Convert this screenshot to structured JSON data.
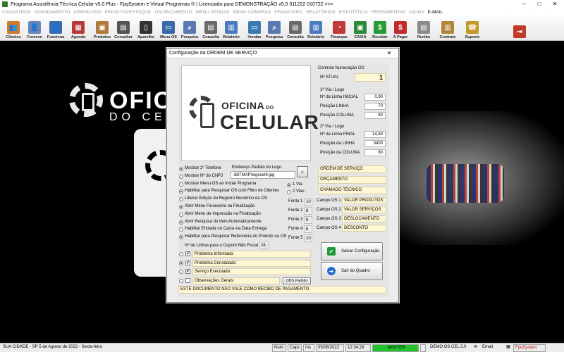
{
  "window": {
    "title": "Programa Assistência Técnica Celular v5.0 Plus - FpqSystem e Virtual Programas ® | Licenciado para  DEMONSTRAÇÃO v5.0 311222 010722 >>>",
    "min_glyph": "–",
    "max_glyph": "□",
    "close_glyph": "✕"
  },
  "menu": [
    "CADASTROS",
    "AGENDAMENTO",
    "APARELHOS",
    "PRODUTO/ESTOQUE",
    "OS/ORÇAMENTO",
    "MENU VENDAS",
    "MENU COMPRAS",
    "FINANCEIRO",
    "RELATÓRIOS",
    "ESTATÍSTICA",
    "FERRAMENTAS",
    "AJUDA",
    "E-MAIL"
  ],
  "toolbar": {
    "buttons": [
      {
        "label": "Clientes",
        "icon": "users-icon",
        "color": "#d07a2a"
      },
      {
        "label": "Fornece",
        "icon": "supplier-icon",
        "color": "#6a86b8"
      },
      {
        "label": "Funciona",
        "icon": "employee-icon",
        "color": "#3a6ab0"
      },
      {
        "label": "Agenda",
        "icon": "calendar-icon",
        "color": "#b73a3a"
      },
      {
        "label": "Produtos",
        "icon": "box-icon",
        "color": "#b07a3a"
      },
      {
        "label": "Consultar",
        "icon": "register-icon",
        "color": "#555555"
      },
      {
        "label": "Aparelho",
        "icon": "phone-icon",
        "color": "#333333"
      },
      {
        "label": "Menu OS",
        "icon": "computer-icon",
        "color": "#3a6aa8"
      },
      {
        "label": "Pesquisa",
        "icon": "search-icon",
        "color": "#5a7ab0"
      },
      {
        "label": "Consulta",
        "icon": "document-icon",
        "color": "#6a6a6a"
      },
      {
        "label": "Relatório",
        "icon": "report-icon",
        "color": "#4a7ac0"
      },
      {
        "label": "Vendas",
        "icon": "sales-icon",
        "color": "#3a7ab0"
      },
      {
        "label": "Pesquisa",
        "icon": "search-icon",
        "color": "#5a7ab0"
      },
      {
        "label": "Consulta",
        "icon": "document-icon",
        "color": "#6a6a6a"
      },
      {
        "label": "Relatório",
        "icon": "report-icon",
        "color": "#4a7ac0"
      },
      {
        "label": "Finanças",
        "icon": "chart-icon",
        "color": "#c03a3a"
      },
      {
        "label": "CAIXA",
        "icon": "cash-icon",
        "color": "#2a8a3a"
      },
      {
        "label": "Receber",
        "icon": "money-in-icon",
        "color": "#2a9a3a"
      },
      {
        "label": "A Pagar",
        "icon": "money-out-icon",
        "color": "#c02a2a"
      },
      {
        "label": "Recibo",
        "icon": "receipt-icon",
        "color": "#8a8a8a"
      },
      {
        "label": "Contrato",
        "icon": "contract-icon",
        "color": "#b0863a"
      },
      {
        "label": "Suporte",
        "icon": "support-icon",
        "color": "#c09a2a"
      },
      {
        "label": "",
        "icon": "exit-icon",
        "color": "#c03a2a"
      }
    ]
  },
  "background": {
    "brand_line1": "OFICINA",
    "brand_line2": "DO CELULAR"
  },
  "dialog": {
    "title": "Configuração da ORDEM DE SERVIÇO",
    "logo": {
      "line1": "OFICINA",
      "line1_small": "DO",
      "line2": "CELULAR"
    },
    "numbering": {
      "group_label": "Controle Numeração OS",
      "n_atual_label": "Nº ATUAL",
      "n_atual_value": "1"
    },
    "via1": {
      "group_label": "1ª Via / Logo",
      "rows": [
        {
          "label": "Nº da Linha INICIAL",
          "value": "0,90"
        },
        {
          "label": "Posição LINHA",
          "value": "70"
        },
        {
          "label": "Posição COLUNA",
          "value": "80"
        }
      ]
    },
    "via2": {
      "group_label": "2ª Via / Logo",
      "rows": [
        {
          "label": "Nº da Linha FINAL",
          "value": "14,50"
        },
        {
          "label": "Posição da LINHA",
          "value": "3400"
        },
        {
          "label": "Posição da COLUNA",
          "value": "80"
        }
      ]
    },
    "logo_path": {
      "label": "Endereço Padrão do Logo",
      "value": ".\\BITMAP\\logocel9.jpg"
    },
    "options": [
      {
        "label": "Mostrar 2º Telefone",
        "selected": true
      },
      {
        "label": "Mostrar Nº do CNPJ",
        "selected": false
      },
      {
        "label": "Mostrar Menu OS ao Iniciar Programa",
        "selected": false
      },
      {
        "label": "Habilitar para Pesquisar OS com Filtro de Clientes",
        "selected": true
      },
      {
        "label": "Liberar Edição do Registro Numérico da OS",
        "selected": false
      },
      {
        "label": "Abrir Menu Financeiro na Finalização",
        "selected": true
      },
      {
        "label": "Abrir Menu de Impressão na Finalização",
        "selected": false
      },
      {
        "label": "Abrir Pesquisa do Item Automaticamente",
        "selected": true
      },
      {
        "label": "Habilitar Entrada no Caixa via Data Entrega",
        "selected": false
      },
      {
        "label": "Habilitar para Pesquisar Referencia do Produto na OS",
        "selected": true
      }
    ],
    "vias": [
      {
        "label": "1 Via",
        "selected": true
      },
      {
        "label": "2 Vias",
        "selected": false
      }
    ],
    "fontes": [
      {
        "label": "Fonte 1",
        "value": "10"
      },
      {
        "label": "Fonte 2",
        "value": "8"
      },
      {
        "label": "Fonte 3",
        "value": "9"
      },
      {
        "label": "Fonte 4",
        "value": "8"
      },
      {
        "label": "Fonte 5",
        "value": "10"
      }
    ],
    "cupom": {
      "label": "Nº de Linhas para o Cupom Não Fiscal",
      "value": "28"
    },
    "headings": [
      "ORDEM DE SERVIÇO",
      "ORÇAMENTO",
      "CHAMADO TÉCNICO"
    ],
    "campos": [
      {
        "label": "Campo OS 1",
        "value": "VALOR PRODUTOS"
      },
      {
        "label": "Campo OS 2",
        "value": "VALOR SERVIÇOS"
      },
      {
        "label": "Campo OS 3",
        "value": "DESLOCAMENTO"
      },
      {
        "label": "Campo OS 4",
        "value": "DESCONTO"
      }
    ],
    "problem_fields": [
      {
        "label": "Problema Informado:",
        "radio": false,
        "checked": true
      },
      {
        "label": "Problema Constatado:",
        "radio": true,
        "checked": true
      },
      {
        "label": "Serviço Executado:",
        "radio": false,
        "checked": true
      },
      {
        "label": "Observações Gerais:",
        "radio": false,
        "checked": false
      }
    ],
    "obs_button": "OBS Padrão",
    "save_button": "Salvar Configuração",
    "exit_button": "Sair do Quadro",
    "footer_text": "ESTE DOCUMENTO NÃO VALE COMO RECIBO DE PAGAMENTO"
  },
  "status": {
    "location": "SUA CIDADE - SP  5 de Agosto de 2022 - Sexta-feira",
    "num": "Num",
    "caps": "Caps",
    "ins": "Ins",
    "date": "05/08/2022",
    "time": "12:34:28",
    "master": "MASTER",
    "demo": "DEMO OS CEL 5.0",
    "email": "Email",
    "brand": "FpqSystem"
  }
}
